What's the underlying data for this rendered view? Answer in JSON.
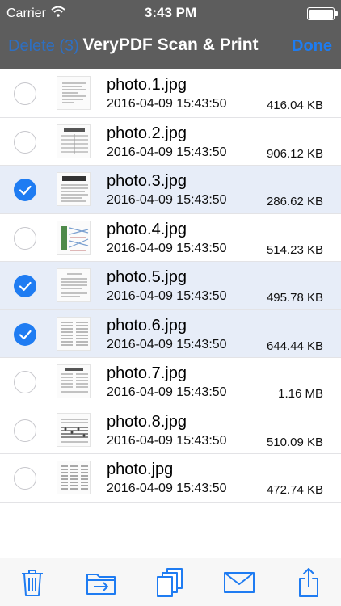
{
  "status": {
    "carrier": "Carrier",
    "time": "3:43 PM"
  },
  "nav": {
    "left_label": "Delete (3)",
    "title": "VeryPDF Scan & Print",
    "right_label": "Done"
  },
  "files": [
    {
      "name": "photo.1.jpg",
      "date": "2016-04-09 15:43:50",
      "size": "416.04 KB",
      "selected": false
    },
    {
      "name": "photo.2.jpg",
      "date": "2016-04-09 15:43:50",
      "size": "906.12 KB",
      "selected": false
    },
    {
      "name": "photo.3.jpg",
      "date": "2016-04-09 15:43:50",
      "size": "286.62 KB",
      "selected": true
    },
    {
      "name": "photo.4.jpg",
      "date": "2016-04-09 15:43:50",
      "size": "514.23 KB",
      "selected": false
    },
    {
      "name": "photo.5.jpg",
      "date": "2016-04-09 15:43:50",
      "size": "495.78 KB",
      "selected": true
    },
    {
      "name": "photo.6.jpg",
      "date": "2016-04-09 15:43:50",
      "size": "644.44 KB",
      "selected": true
    },
    {
      "name": "photo.7.jpg",
      "date": "2016-04-09 15:43:50",
      "size": "1.16 MB",
      "selected": false
    },
    {
      "name": "photo.8.jpg",
      "date": "2016-04-09 15:43:50",
      "size": "510.09 KB",
      "selected": false
    },
    {
      "name": "photo.jpg",
      "date": "2016-04-09 15:43:50",
      "size": "472.74 KB",
      "selected": false
    }
  ],
  "toolbar": {
    "icons": [
      "trash-icon",
      "move-to-folder-icon",
      "copy-icon",
      "mail-icon",
      "share-icon"
    ]
  },
  "colors": {
    "bar_bg": "#5d5d5d",
    "accent": "#1f7cf2",
    "selected_row": "#e7edf8",
    "delete_label": "#2f6fc0"
  }
}
